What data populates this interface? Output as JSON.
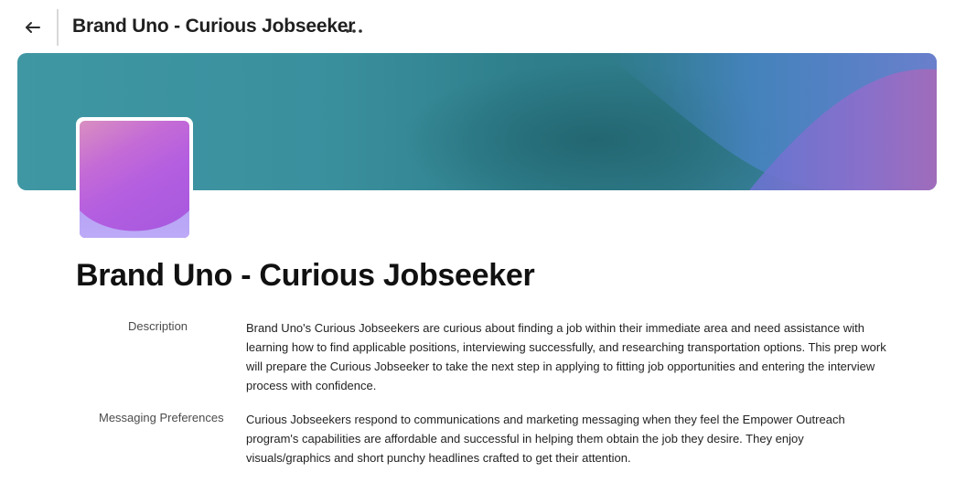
{
  "header": {
    "title": "Brand Uno - Curious Jobseeker",
    "back_icon": "arrow-left-icon",
    "more_icon": "more-horizontal-icon"
  },
  "banner": {
    "colors": [
      "#3f97a3",
      "#2f7a88",
      "#4a7fc8",
      "#9a6cc0"
    ]
  },
  "avatar": {
    "colors": [
      "#d98fc0",
      "#b45ee0",
      "#b9a6f5"
    ]
  },
  "profile": {
    "title": "Brand Uno - Curious Jobseeker",
    "fields": [
      {
        "label": "Description",
        "value": "Brand Uno's Curious Jobseekers are curious about finding a job within their immediate area and need assistance with learning how to find applicable positions, interviewing successfully, and researching transportation options. This prep work will prepare the Curious Jobseeker to take the next step in applying to fitting job opportunities and entering the interview process with confidence."
      },
      {
        "label": "Messaging Preferences",
        "value": "Curious Jobseekers respond to communications and marketing messaging when they feel the Empower Outreach program's capabilities are affordable and successful in helping them obtain the job they desire. They enjoy visuals/graphics and short punchy headlines crafted to get their attention."
      }
    ]
  }
}
